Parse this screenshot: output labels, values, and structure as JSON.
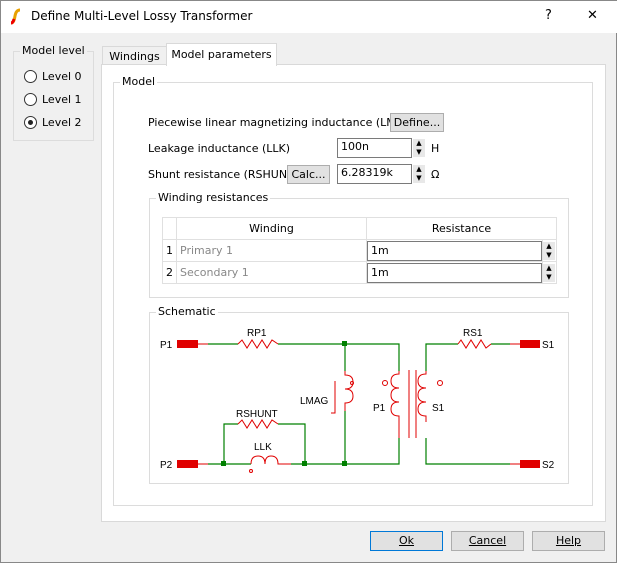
{
  "window": {
    "title": "Define Multi-Level Lossy Transformer",
    "help": "?",
    "close": "✕"
  },
  "model_level": {
    "title": "Model level",
    "options": [
      "Level 0",
      "Level 1",
      "Level 2"
    ],
    "selected": "Level 2"
  },
  "tabs": [
    "Windings",
    "Model parameters"
  ],
  "active_tab": "Model parameters",
  "model": {
    "title": "Model",
    "lmag_label": "Piecewise linear magnetizing inductance (LMAG)",
    "define_btn": "Define...",
    "llk_label": "Leakage inductance (LLK)",
    "llk_value": "100n",
    "llk_unit": "H",
    "rshunt_label": "Shunt resistance (RSHUNT)",
    "calc_btn": "Calc...",
    "rshunt_value": "6.28319k",
    "rshunt_unit": "Ω"
  },
  "winding_resistances": {
    "title": "Winding resistances",
    "headers": [
      "Winding",
      "Resistance"
    ],
    "rows": [
      {
        "n": "1",
        "winding": "Primary 1",
        "resistance": "1m"
      },
      {
        "n": "2",
        "winding": "Secondary 1",
        "resistance": "1m"
      }
    ]
  },
  "schematic": {
    "title": "Schematic",
    "labels": {
      "p1": "P1",
      "p2": "P2",
      "s1": "S1",
      "s2": "S2",
      "rp1": "RP1",
      "rs1": "RS1",
      "rshunt": "RSHUNT",
      "llk": "LLK",
      "lmag": "LMAG",
      "pw": "P1",
      "sw": "S1"
    },
    "colors": {
      "wire": "#008000",
      "component": "#e00000"
    }
  },
  "buttons": {
    "ok": "Ok",
    "cancel": "Cancel",
    "help": "Help"
  }
}
